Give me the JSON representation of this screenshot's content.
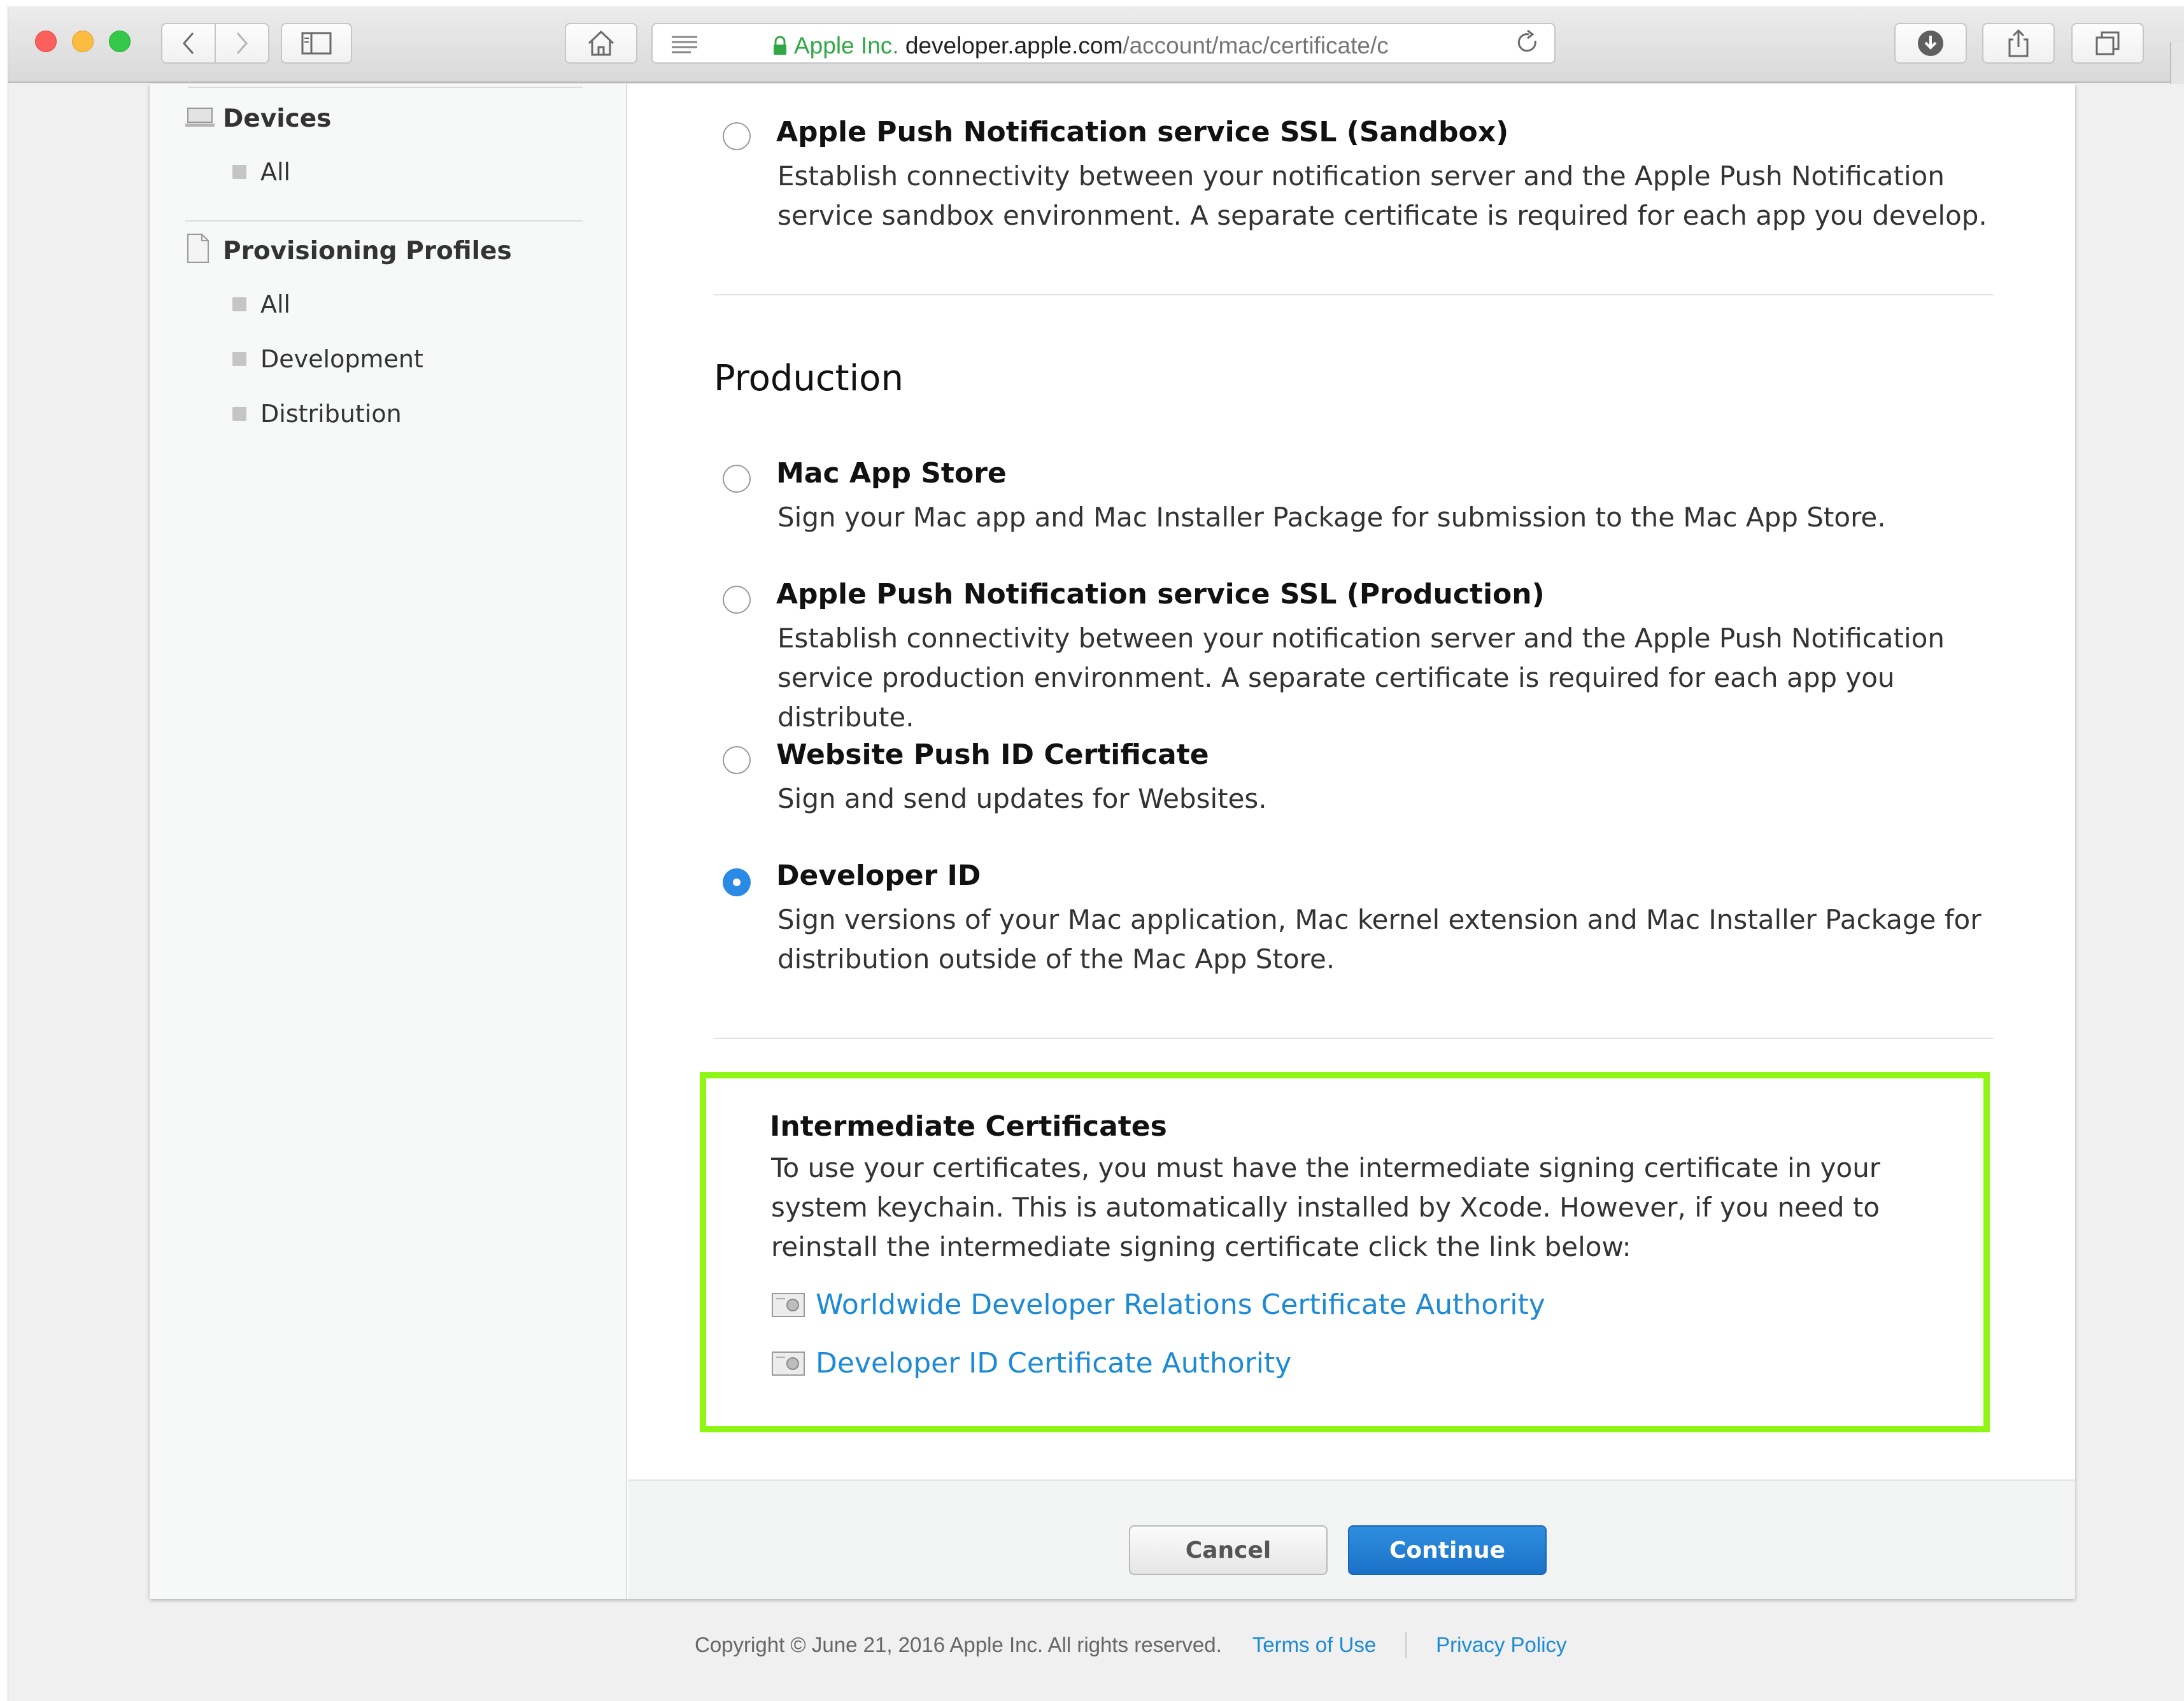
{
  "browser": {
    "url_org": "Apple Inc.",
    "url_domain": "developer.apple.com",
    "url_path": "/account/mac/certificate/c"
  },
  "sidebar": {
    "sections": [
      {
        "title": "Devices",
        "items": [
          "All"
        ]
      },
      {
        "title": "Provisioning Profiles",
        "items": [
          "All",
          "Development",
          "Distribution"
        ]
      }
    ]
  },
  "options_top": [
    {
      "title": "Apple Push Notification service SSL (Sandbox)",
      "desc": "Establish connectivity between your notification server and the Apple Push Notification service sandbox environment. A separate certificate is required for each app you develop.",
      "checked": false
    }
  ],
  "production": {
    "heading": "Production",
    "options": [
      {
        "title": "Mac App Store",
        "desc": "Sign your Mac app and Mac Installer Package for submission to the Mac App Store.",
        "checked": false
      },
      {
        "title": "Apple Push Notification service SSL (Production)",
        "desc": "Establish connectivity between your notification server and the Apple Push Notification service production environment. A separate certificate is required for each app you distribute.",
        "checked": false
      },
      {
        "title": "Website Push ID Certificate",
        "desc": "Sign and send updates for Websites.",
        "checked": false
      },
      {
        "title": "Developer ID",
        "desc": "Sign versions of your Mac application, Mac kernel extension and Mac Installer Package for distribution outside of the Mac App Store.",
        "checked": true
      }
    ]
  },
  "intermediate": {
    "title": "Intermediate Certificates",
    "desc": "To use your certificates, you must have the intermediate signing certificate in your system keychain. This is automatically installed by Xcode. However, if you need to reinstall the intermediate signing certificate click the link below:",
    "links": [
      "Worldwide Developer Relations Certificate Authority",
      "Developer ID Certificate Authority"
    ]
  },
  "actions": {
    "cancel": "Cancel",
    "continue": "Continue"
  },
  "footer": {
    "copyright": "Copyright © June 21, 2016 Apple Inc. All rights reserved.",
    "terms": "Terms of Use",
    "privacy": "Privacy Policy"
  },
  "colors": {
    "accent": "#1c8ad4",
    "highlight_box": "#8ef515",
    "primary_button": "#1a72c7"
  }
}
